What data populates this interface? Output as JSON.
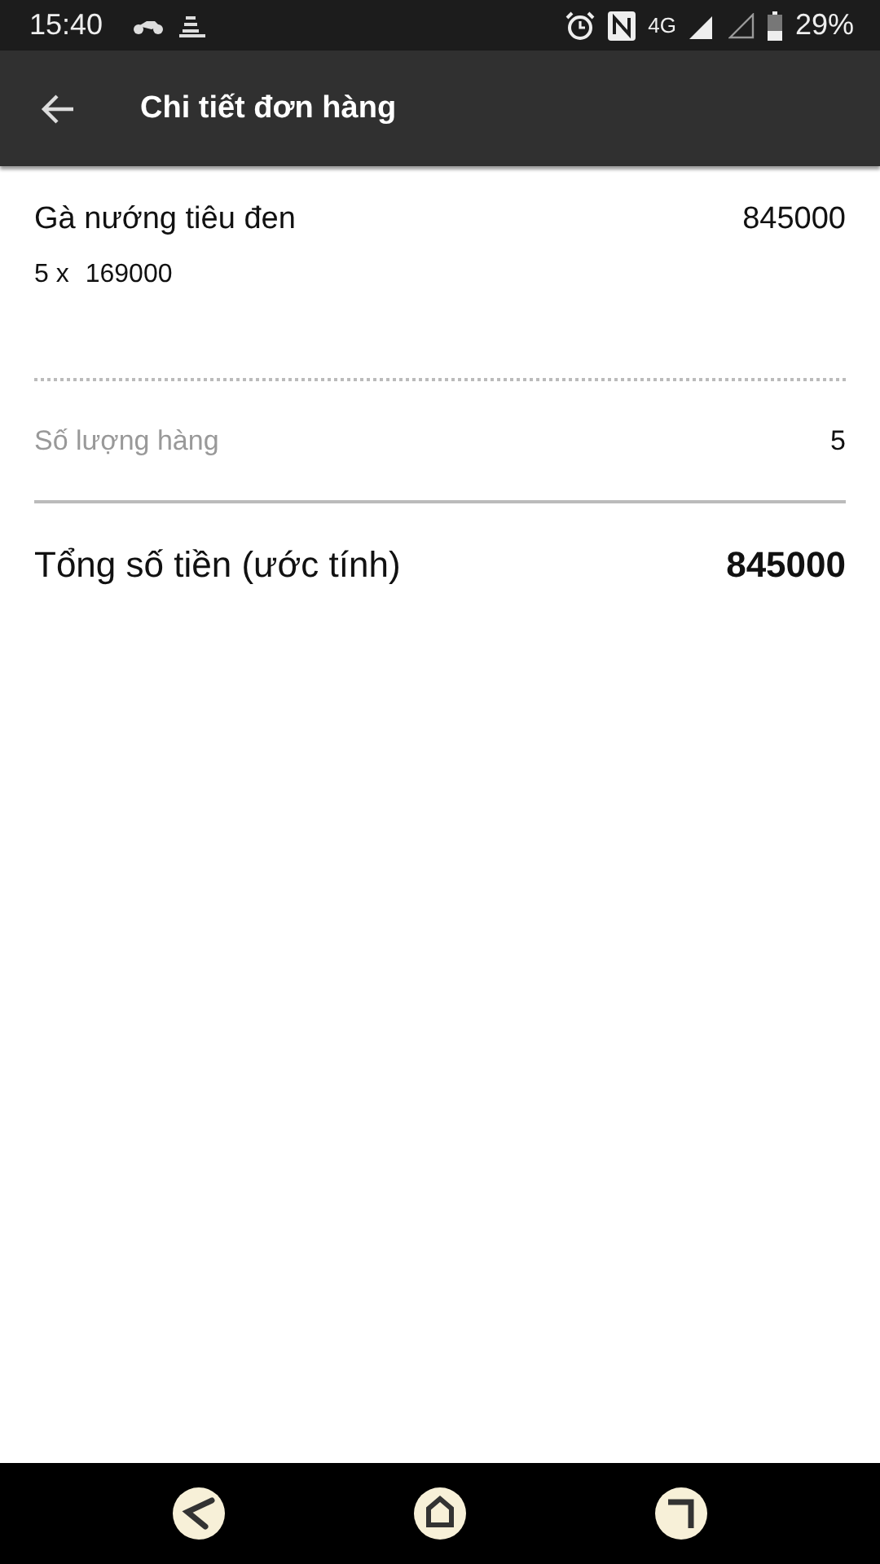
{
  "status_bar": {
    "time": "15:40",
    "network": "4G",
    "battery": "29%"
  },
  "app_bar": {
    "title": "Chi tiết đơn hàng"
  },
  "items": [
    {
      "name": "Gà nướng tiêu đen",
      "amount": "845000",
      "quantity": "5 x",
      "unit_price": "169000"
    }
  ],
  "summary": {
    "label": "Số lượng hàng",
    "value": "5"
  },
  "total": {
    "label": "Tổng số tiền (ước tính)",
    "value": "845000"
  }
}
